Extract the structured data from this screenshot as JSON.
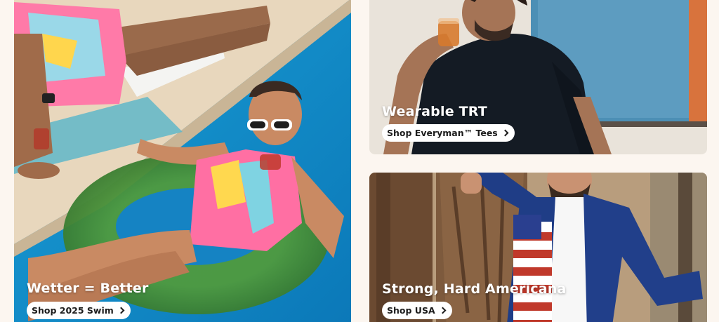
{
  "cards": [
    {
      "title": "Wetter = Better",
      "cta": "Shop 2025 Swim",
      "image": "pool-swimwear-photo"
    },
    {
      "title": "Wearable TRT",
      "cta": "Shop Everyman™ Tees",
      "image": "man-drinking-tee-photo"
    },
    {
      "title": "Strong, Hard Americana",
      "cta": "Shop USA",
      "image": "americana-blazer-photo"
    }
  ],
  "colors": {
    "page_bg": "#fcf6f0",
    "pill_bg": "#ffffff",
    "title_text": "#ffffff"
  }
}
